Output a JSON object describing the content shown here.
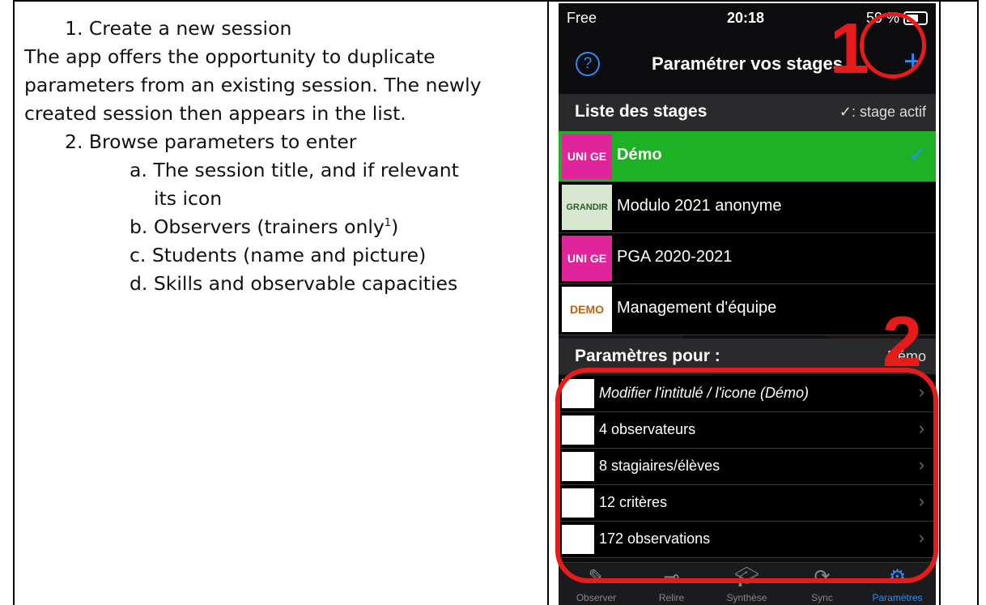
{
  "doc": {
    "item1": "1.  Create a new session",
    "para": "The app offers the opportunity to duplicate parameters from an existing session. The newly created session then appears in the list.",
    "para_lines": [
      "The app offers the opportunity to duplicate",
      "parameters from an existing session. The newly",
      "created session then appears in the list."
    ],
    "item2": "2.  Browse parameters to enter",
    "sub_a_1": "a.  The session title, and if relevant",
    "sub_a_2": "its icon",
    "sub_b": "b.  Observers (trainers only",
    "sub_b_sup": "1",
    "sub_b_end": ")",
    "sub_c": "c.  Students (name and picture)",
    "sub_d": "d.  Skills and observable capacities"
  },
  "phone": {
    "status": {
      "carrier": "Free",
      "time": "20:18",
      "battery": "59 %"
    },
    "nav": {
      "title": "Paramétrer vos stages",
      "help": "?",
      "add": "+"
    },
    "list_header": {
      "label": "Liste des stages",
      "hint": "✓: stage actif"
    },
    "stages": [
      {
        "name": "Démo",
        "thumb": "UNI GE",
        "active": true
      },
      {
        "name": "Modulo 2021 anonyme",
        "thumb": "GRANDIR"
      },
      {
        "name": "PGA 2020-2021",
        "thumb": "UNI GE"
      },
      {
        "name": "Management d'équipe",
        "thumb": "DEMO"
      }
    ],
    "params_header": {
      "label": "Paramètres pour :",
      "value": "Démo"
    },
    "params": [
      {
        "label": "Modifier l'intitulé / l'icone (Démo)"
      },
      {
        "label": "4 observateurs"
      },
      {
        "label": "8 stagiaires/élèves"
      },
      {
        "label": "12 critères"
      },
      {
        "label": "172 observations"
      }
    ],
    "tabs": [
      "Observer",
      "Relire",
      "Synthèse",
      "Sync",
      "Paramètres"
    ]
  },
  "annotations": {
    "one": "1",
    "two": "2"
  },
  "colors": {
    "accent": "#2f8cf5",
    "active_row": "#1fb125",
    "annotation": "#e81b1b"
  }
}
